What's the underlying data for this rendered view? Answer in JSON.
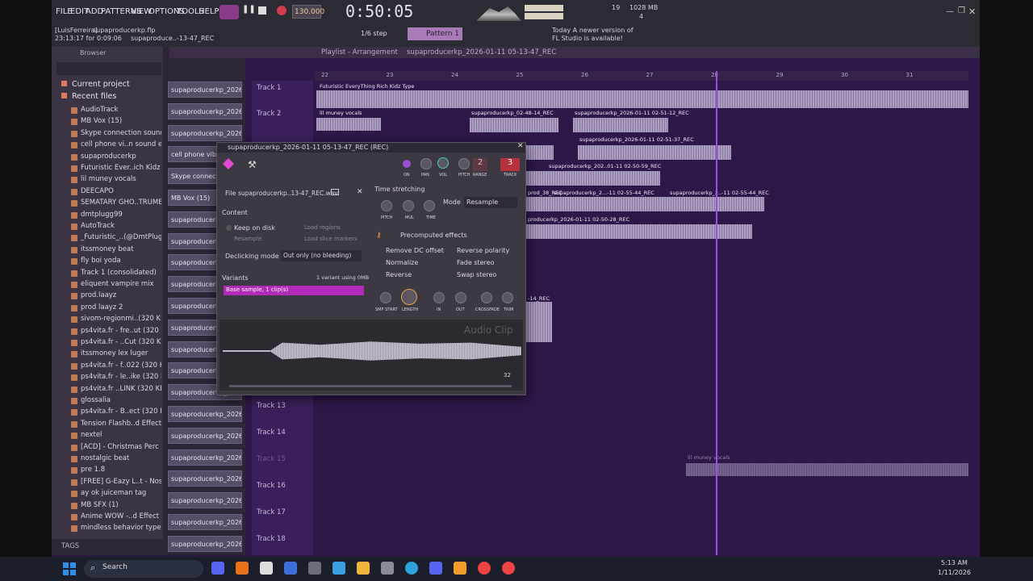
{
  "menu": [
    "FILE",
    "EDIT",
    "ADD",
    "PATTERNS",
    "VIEW",
    "OPTIONS",
    "TOOLS",
    "HELP"
  ],
  "transport": {
    "time": "0:50:05",
    "tempo": "130.000",
    "snap": "1/6 step",
    "pattern": "Pattern 1",
    "cpu": "19",
    "mem": "1028 MB",
    "voices": "4"
  },
  "hint": {
    "user": "[LuisFerreira]",
    "file": "supaproducerkp.flp",
    "time": "23:13:17 for 0:09:06",
    "tooltip": "supaproduce..-13-47_REC"
  },
  "news": {
    "line1": "Today  A newer version of",
    "line2": "FL Studio is available!"
  },
  "browser": {
    "title": "Browser",
    "current_project": "Current project",
    "recent_files": "Recent files",
    "items": [
      "AudioTrack",
      "MB Vox (15)",
      "Skype connection sound",
      "cell phone vi..n sound effect",
      "supaproducerkp",
      "Futuristic Ever..ich Kidz Type",
      "lil muney vocals",
      "DEECAPO",
      "SEMATARY GHO..TRUMENTAL",
      "dmtplugg99",
      "AutoTrack",
      "_Futuristic_..(@DmtPlugg99)",
      "itssmoney beat",
      "fly boi yoda",
      "Track 1 (consolidated)",
      "eliquent vampire mix",
      "prod.laayz",
      "prod laayz 2",
      "sivom-regionmi..(320 KBps)",
      "ps4vita.fr - fre..ut (320 KBps)",
      "ps4vita.fr - ..Cut (320 KBps)",
      "itssmoney lex luger",
      "ps4vita.fr - f..022 (320 KBps)",
      "ps4vita.fr - le..ike (320 KBps)",
      "ps4vita.fr ..LINK (320 KBps)",
      "glossalia",
      "ps4vita.fr - B..ect (320 KBps)",
      "Tension Flashb..d Effect (HD)",
      "nextel",
      "[ACD] - Christmas Perc",
      "nostalgic beat",
      "pre 1.8",
      "[FREE] G-Eazy L..t - Nostalgic",
      "ay ok juiceman tag",
      "MB SFX (1)",
      "Anime WOW -..d Effect (HD)",
      "mindless behavior type beat"
    ],
    "tags": "TAGS"
  },
  "clips": [
    "supaproducerkp_2026-0...",
    "supaproducerkp_2026-0...",
    "supaproducerkp_2026-0...",
    "cell phone vibrat",
    "Skype connectio",
    "MB Vox (15)",
    "supaproducerkp_2026-0...",
    "supaproducerkp_2026-0...",
    "supaproducerkp_2026-0...",
    "supaproducerkp_2026-0...",
    "supaproducerkp_2026-0...",
    "supaproducerkp_2026-0...",
    "supaproducerkp_2026-0...",
    "supaproducerkp_2026-0...",
    "supaproducerkp_2026-0...",
    "supaproducerkp_2026-0...",
    "supaproducerkp_2026-0...",
    "supaproducerkp_2026-0...",
    "supaproducerkp_2026-0...",
    "supaproducerkp_2026-0...",
    "supaproducerkp_2026-0...",
    "supaproducerkp_2026-0..."
  ],
  "playlist": {
    "title": "Playlist - Arrangement",
    "pattern": "supaproducerkp_2026-01-11 05-13-47_REC",
    "ruler": [
      "22",
      "23",
      "24",
      "25",
      "26",
      "27",
      "28",
      "29",
      "30",
      "31"
    ],
    "tracks": [
      "Track 1",
      "Track 2",
      "Track 13",
      "Track 14",
      "Track 15",
      "Track 16",
      "Track 17",
      "Track 18"
    ],
    "clip_labels": [
      "Futuristic EveryThing Rich Kidz Type",
      "lil muney vocals",
      "supaproducerkp_02-48-14_REC",
      "supaproducerkp_2026-01-11 02-51-12_REC",
      "supaproducerkp_2026-01-11 02-51-37_REC",
      "supaproducerkp_02-48-46_REC",
      "supaproducerkp_202..01-11 02-50-59_REC",
      "prod_38_REC",
      "supaproducerkp_2...-11 02-55-44_REC",
      "supaproducerkp_2..-11 02-55-44_REC",
      "producerkp_2026-01-11 02-50-28_REC",
      "-14_REC",
      "lil muney vocals"
    ]
  },
  "dialog": {
    "title": "supaproducerkp_2026-01-11 05-13-47_REC (REC)",
    "file_label": "File",
    "file_name": "supaproducerkp..13-47_REC.wav",
    "content": "Content",
    "keep_on_disk": "Keep on disk",
    "load_regions": "Load regions",
    "resample": "Resample",
    "load_slice": "Load slice markers",
    "declicking": "Declicking mode",
    "declicking_value": "Out only (no bleeding)",
    "variants": "Variants",
    "variants_info": "1 variant using 0MB",
    "variant_item": "Base sample, 1 clip(s)",
    "time_stretching": "Time stretching",
    "mode_label": "Mode",
    "mode_value": "Resample",
    "knob_pitch": "PITCH",
    "knob_mul": "MUL",
    "knob_time": "TIME",
    "precomputed": "Precomputed effects",
    "fx": [
      "Remove DC offset",
      "Reverse polarity",
      "Normalize",
      "Fade stereo",
      "Reverse",
      "Swap stereo"
    ],
    "env_labels": [
      "SMP START",
      "LENGTH",
      "IN",
      "OUT",
      "CROSSFADE",
      "TRIM"
    ],
    "top_labels": [
      "ON",
      "PAN",
      "VOL",
      "PITCH",
      "RANGE",
      "TRACK"
    ],
    "range_val": "2",
    "track_val": "3",
    "watermark": "Audio Clip",
    "zoom": "32"
  },
  "taskbar": {
    "search": "Search",
    "time": "5:13 AM",
    "date": "1/11/2026"
  }
}
